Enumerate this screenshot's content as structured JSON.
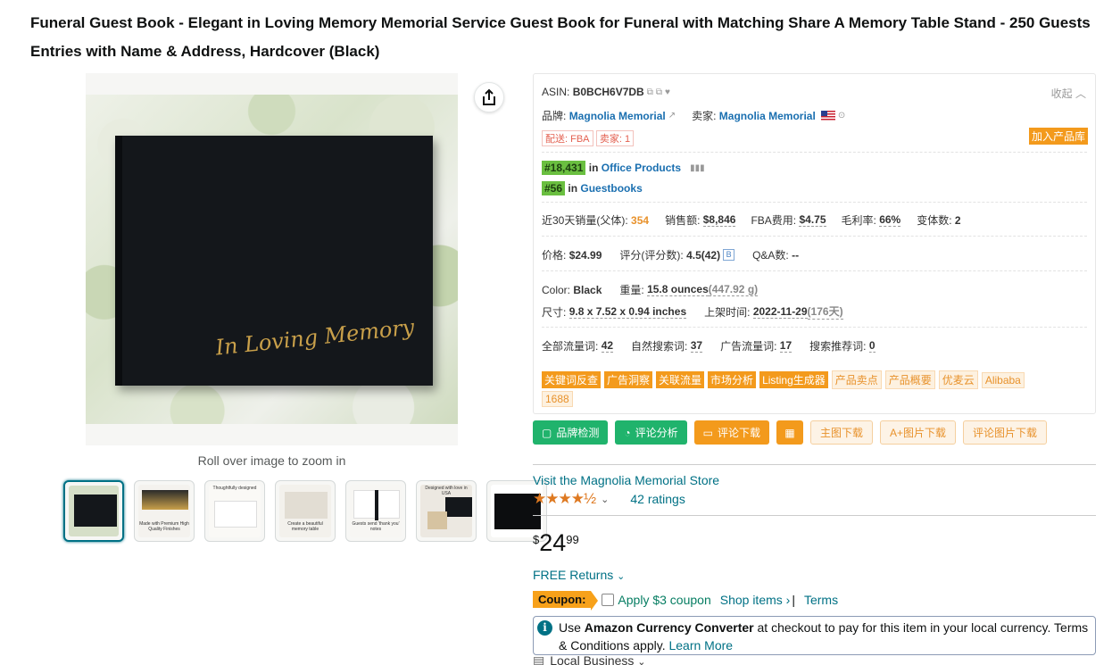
{
  "product": {
    "title": "Funeral Guest Book - Elegant in Loving Memory Memorial Service Guest Book for Funeral with Matching Share A Memory Table Stand - 250 Guests Entries with Name & Address, Hardcover (Black)",
    "image_text": "In Loving Memory",
    "zoom_hint": "Roll over image to zoom in",
    "thumbnails": [
      {
        "caption": ""
      },
      {
        "caption": "Made with Premium High Quality Finishes"
      },
      {
        "caption": "Thoughtfully designed"
      },
      {
        "caption": "Create a beautiful memory table"
      },
      {
        "caption": "Guests send 'thank you' notes"
      },
      {
        "caption": "Designed with love in USA"
      },
      {
        "caption": ""
      }
    ]
  },
  "panel": {
    "asin_label": "ASIN:",
    "asin": "B0BCH6V7DB",
    "collapse": "收起",
    "brand_label": "品牌:",
    "brand": "Magnolia Memorial",
    "seller_label": "卖家:",
    "seller": "Magnolia Memorial",
    "tag_fba": "配送: FBA",
    "tag_sellers": "卖家: 1",
    "add_library": "加入产品库",
    "rank1": "#18,431",
    "rank1_in": "in",
    "rank1_cat": "Office Products",
    "rank2": "#56",
    "rank2_in": "in",
    "rank2_cat": "Guestbooks",
    "sales30_label": "近30天销量(父体):",
    "sales30": "354",
    "revenue_label": "销售额:",
    "revenue": "$8,846",
    "fba_label": "FBA费用:",
    "fba": "$4.75",
    "margin_label": "毛利率:",
    "margin": "66%",
    "variants_label": "变体数:",
    "variants": "2",
    "price_label": "价格:",
    "price": "$24.99",
    "rating_label": "评分(评分数):",
    "rating": "4.5(42)",
    "rating_icon": "B",
    "qa_label": "Q&A数:",
    "qa": "--",
    "color_label": "Color:",
    "color": "Black",
    "weight_label": "重量:",
    "weight": "15.8 ounces",
    "weight_g": "(447.92 g)",
    "size_label": "尺寸:",
    "size": "9.8 x 7.52 x 0.94 inches",
    "listed_label": "上架时间:",
    "listed": "2022-11-29",
    "listed_days": "(176天)",
    "kw_all_label": "全部流量词:",
    "kw_all": "42",
    "kw_organic_label": "自然搜索词:",
    "kw_organic": "37",
    "kw_ad_label": "广告流量词:",
    "kw_ad": "17",
    "kw_rec_label": "搜索推荐词:",
    "kw_rec": "0",
    "tags_solid": [
      "关键词反查",
      "广告洞察",
      "关联流量",
      "市场分析",
      "Listing生成器"
    ],
    "tags_light": [
      "产品卖点",
      "产品概要",
      "优麦云",
      "Alibaba"
    ],
    "tag_1688": "1688"
  },
  "tools": {
    "brand_check": "品牌检测",
    "review_analysis": "评论分析",
    "review_download": "评论下载",
    "main_img_download": "主图下载",
    "aplus_download": "A+图片下载",
    "review_img_download": "评论图片下载"
  },
  "buybox": {
    "store_link": "Visit the Magnolia Memorial Store",
    "stars": "★★★★½",
    "ratings": "42 ratings",
    "price_symbol": "$",
    "price_whole": "24",
    "price_fraction": "99",
    "returns": "FREE Returns",
    "coupon_badge": "Coupon:",
    "coupon_apply": "Apply $3 coupon",
    "shop_items": "Shop items ›",
    "separator": "|",
    "terms": "Terms",
    "currency_pre": "Use ",
    "currency_bold": "Amazon Currency Converter",
    "currency_post": " at checkout to pay for this item in your local currency. Terms & Conditions apply. ",
    "learn_more": "Learn More",
    "local_business": "Local Business"
  },
  "colors": {
    "accent_orange": "#f39a1c",
    "accent_green": "#20b36c",
    "link_teal": "#007185",
    "rank_green": "#6abf40"
  }
}
